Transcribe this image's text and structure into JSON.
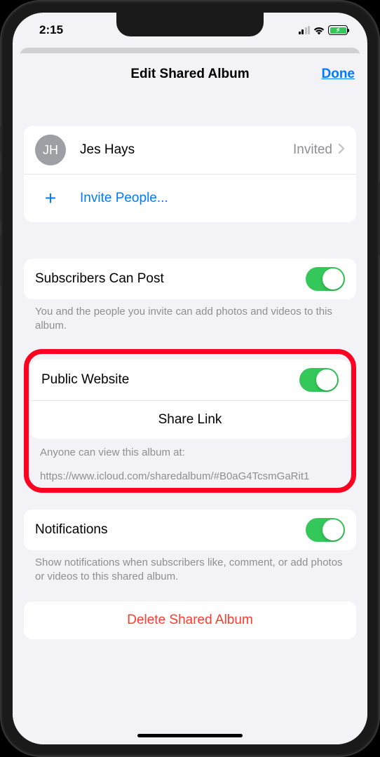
{
  "status": {
    "time": "2:15"
  },
  "nav": {
    "title": "Edit Shared Album",
    "done": "Done"
  },
  "people": {
    "member": {
      "initials": "JH",
      "name": "Jes Hays",
      "status": "Invited"
    },
    "invite_label": "Invite People..."
  },
  "subscribers": {
    "label": "Subscribers Can Post",
    "footer": "You and the people you invite can add photos and videos to this album."
  },
  "public": {
    "label": "Public Website",
    "share_label": "Share Link",
    "footer_intro": "Anyone can view this album at:",
    "url": "https://www.icloud.com/sharedalbum/#B0aG4TcsmGaRit1"
  },
  "notifications": {
    "label": "Notifications",
    "footer": "Show notifications when subscribers like, comment, or add photos or videos to this shared album."
  },
  "delete": {
    "label": "Delete Shared Album"
  }
}
